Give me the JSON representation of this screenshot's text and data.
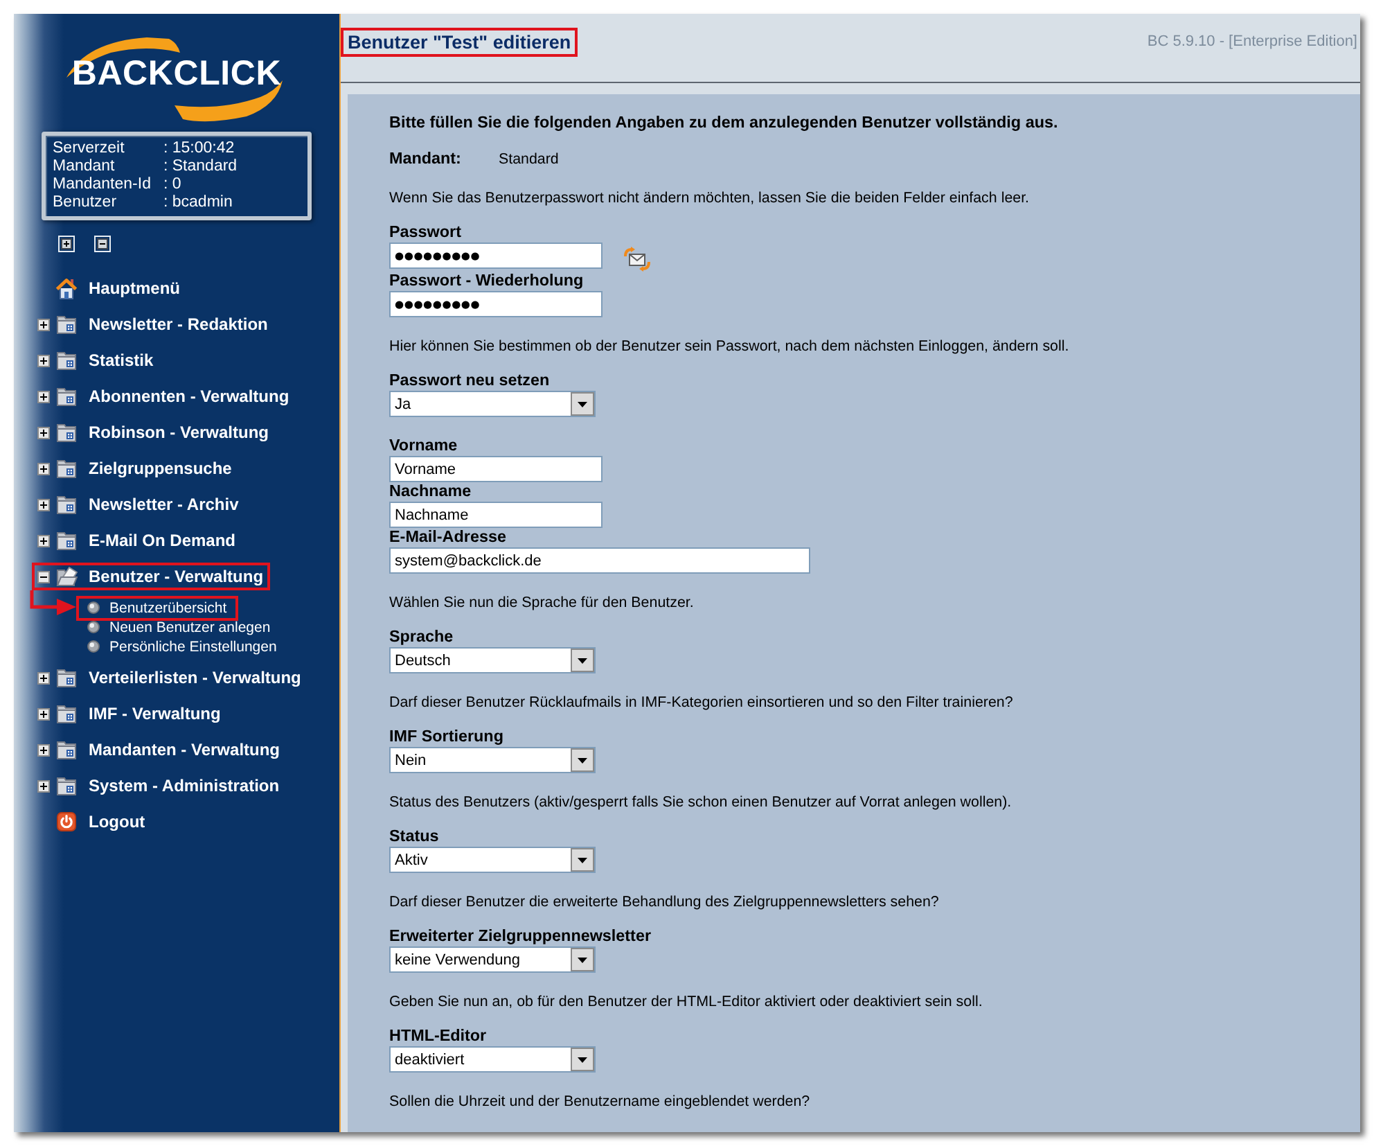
{
  "sidebar": {
    "logo": "BACKCLICK",
    "info": [
      {
        "label": "Serverzeit",
        "value": ": 15:00:42"
      },
      {
        "label": "Mandant",
        "value": ": Standard"
      },
      {
        "label": "Mandanten-Id",
        "value": ": 0"
      },
      {
        "label": "Benutzer",
        "value": ": bcadmin"
      }
    ],
    "menu": [
      {
        "kind": "home",
        "label": "Hauptmenü",
        "highlighted": false
      },
      {
        "kind": "folder",
        "label": "Newsletter - Redaktion",
        "expanded": false,
        "highlighted": false
      },
      {
        "kind": "folder",
        "label": "Statistik",
        "expanded": false,
        "highlighted": false
      },
      {
        "kind": "folder",
        "label": "Abonnenten - Verwaltung",
        "expanded": false,
        "highlighted": false
      },
      {
        "kind": "folder",
        "label": "Robinson - Verwaltung",
        "expanded": false,
        "highlighted": false
      },
      {
        "kind": "folder",
        "label": "Zielgruppensuche",
        "expanded": false,
        "highlighted": false
      },
      {
        "kind": "folder",
        "label": "Newsletter - Archiv",
        "expanded": false,
        "highlighted": false
      },
      {
        "kind": "folder",
        "label": "E-Mail On Demand",
        "expanded": false,
        "highlighted": false
      },
      {
        "kind": "folder",
        "label": "Benutzer - Verwaltung",
        "expanded": true,
        "highlighted": true,
        "children": [
          {
            "label": "Benutzerübersicht",
            "highlighted": true,
            "arrow": true
          },
          {
            "label": "Neuen Benutzer anlegen",
            "highlighted": false,
            "arrow": false
          },
          {
            "label": "Persönliche Einstellungen",
            "highlighted": false,
            "arrow": false
          }
        ]
      },
      {
        "kind": "folder",
        "label": "Verteilerlisten - Verwaltung",
        "expanded": false,
        "highlighted": false
      },
      {
        "kind": "folder",
        "label": "IMF - Verwaltung",
        "expanded": false,
        "highlighted": false
      },
      {
        "kind": "folder",
        "label": "Mandanten - Verwaltung",
        "expanded": false,
        "highlighted": false
      },
      {
        "kind": "folder",
        "label": "System - Administration",
        "expanded": false,
        "highlighted": false
      },
      {
        "kind": "logout",
        "label": "Logout",
        "highlighted": false
      }
    ]
  },
  "header": {
    "title": "Benutzer \"Test\" editieren",
    "highlighted": true,
    "version": "BC 5.9.10 - [Enterprise Edition]"
  },
  "form": {
    "intro": "Bitte füllen Sie die folgenden Angaben zu dem anzulegenden Benutzer vollständig aus.",
    "mandant": {
      "label": "Mandant:",
      "value": "Standard"
    },
    "sections": [
      {
        "note": "Wenn Sie das Benutzerpasswort nicht ändern möchten, lassen Sie die beiden Felder einfach leer.",
        "fields": [
          {
            "kind": "password",
            "label": "Passwort",
            "value": "●●●●●●●●●",
            "generator": true
          },
          {
            "kind": "password",
            "label": "Passwort - Wiederholung",
            "value": "●●●●●●●●●",
            "generator": false
          }
        ]
      },
      {
        "note": "Hier können Sie bestimmen ob der Benutzer sein Passwort, nach dem nächsten Einloggen, ändern soll.",
        "fields": [
          {
            "kind": "select",
            "label": "Passwort neu setzen",
            "value": "Ja"
          }
        ]
      },
      {
        "fields": [
          {
            "kind": "text",
            "label": "Vorname",
            "value": "Vorname"
          },
          {
            "kind": "text",
            "label": "Nachname",
            "value": "Nachname"
          },
          {
            "kind": "email",
            "label": "E-Mail-Adresse",
            "value": "system@backclick.de"
          }
        ]
      },
      {
        "note": "Wählen Sie nun die Sprache für den Benutzer.",
        "fields": [
          {
            "kind": "select",
            "label": "Sprache",
            "value": "Deutsch"
          }
        ]
      },
      {
        "note": "Darf dieser Benutzer Rücklaufmails in IMF-Kategorien einsortieren und so den Filter trainieren?",
        "fields": [
          {
            "kind": "select",
            "label": "IMF Sortierung",
            "value": "Nein"
          }
        ]
      },
      {
        "note": "Status des Benutzers (aktiv/gesperrt falls Sie schon einen Benutzer auf Vorrat anlegen wollen).",
        "fields": [
          {
            "kind": "select",
            "label": "Status",
            "value": "Aktiv"
          }
        ]
      },
      {
        "note": "Darf dieser Benutzer die erweiterte Behandlung des Zielgruppennewsletters sehen?",
        "fields": [
          {
            "kind": "select",
            "label": "Erweiterter Zielgruppennewsletter",
            "value": "keine Verwendung"
          }
        ]
      },
      {
        "note": "Geben Sie nun an, ob für den Benutzer der HTML-Editor aktiviert oder deaktiviert sein soll.",
        "fields": [
          {
            "kind": "select",
            "label": "HTML-Editor",
            "value": "deaktiviert"
          }
        ]
      },
      {
        "note": "Sollen die Uhrzeit und der Benutzername eingeblendet werden?"
      }
    ]
  }
}
